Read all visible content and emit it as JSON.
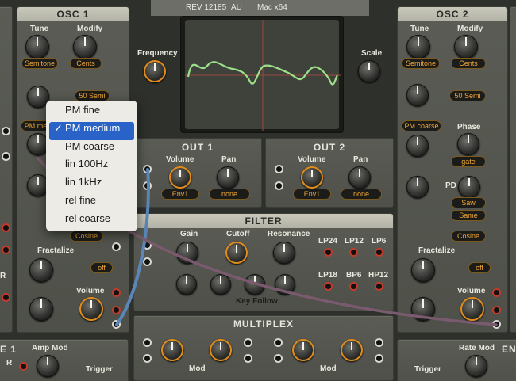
{
  "topbar": {
    "rev": "REV 12185",
    "format": "AU",
    "platform": "Mac x64"
  },
  "osc1": {
    "title": "OSC 1",
    "tune_label": "Tune",
    "modify_label": "Modify",
    "tune_value": "Semitone",
    "modify_value": "Cents",
    "semi_value": "50 Semi",
    "pm_value": "PM me",
    "cosine_value": "Cosine",
    "fractalize_label": "Fractalize",
    "fractalize_value": "off",
    "volume_label": "Volume"
  },
  "osc2": {
    "title": "OSC 2",
    "tune_label": "Tune",
    "modify_label": "Modify",
    "tune_value": "Semitone",
    "modify_value": "Cents",
    "semi_value": "50 Semi",
    "pm_value": "PM coarse",
    "phase_label": "Phase",
    "phase_value": "gate",
    "pd_label": "PD",
    "saw_value": "Saw",
    "same_value": "Same",
    "cosine_value": "Cosine",
    "fractalize_label": "Fractalize",
    "fractalize_value": "off",
    "volume_label": "Volume"
  },
  "scope": {
    "frequency_label": "Frequency",
    "scale_label": "Scale"
  },
  "out1": {
    "title": "OUT 1",
    "volume_label": "Volume",
    "pan_label": "Pan",
    "volume_value": "Env1",
    "pan_value": "none"
  },
  "out2": {
    "title": "OUT 2",
    "volume_label": "Volume",
    "pan_label": "Pan",
    "volume_value": "Env1",
    "pan_value": "none"
  },
  "filter": {
    "title": "FILTER",
    "gain_label": "Gain",
    "cutoff_label": "Cutoff",
    "resonance_label": "Resonance",
    "keyfollow_label": "Key Follow",
    "outputs_top": [
      "LP24",
      "LP12",
      "LP6"
    ],
    "outputs_bottom": [
      "LP18",
      "BP6",
      "HP12"
    ]
  },
  "multiplex": {
    "title": "MULTIPLEX",
    "mod_label": "Mod"
  },
  "bottom_left": {
    "title": "E 1",
    "amp_mod_label": "Amp Mod",
    "trigger_label": "Trigger",
    "r_label": "R"
  },
  "bottom_right": {
    "title": "EN",
    "rate_mod_label": "Rate Mod",
    "trigger_label": "Trigger"
  },
  "left_edge_label": "R",
  "menu": {
    "items": [
      "PM fine",
      "PM medium",
      "PM coarse",
      "lin 100Hz",
      "lin 1kHz",
      "rel fine",
      "rel coarse"
    ],
    "selected": "PM medium",
    "check": "✓"
  }
}
